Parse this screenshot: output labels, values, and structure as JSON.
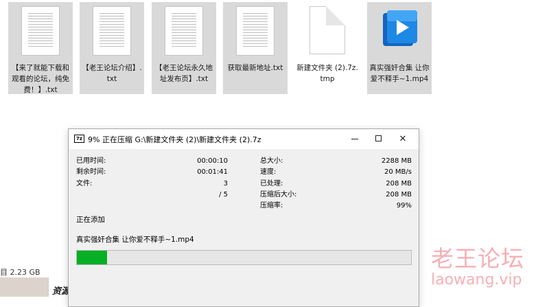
{
  "files": [
    {
      "name": "【来了就能下载和观看的论坛，纯免费！】.txt",
      "kind": "text-document"
    },
    {
      "name": "【老王论坛介绍】.txt",
      "kind": "text-document"
    },
    {
      "name": "【老王论坛永久地址发布页】.txt",
      "kind": "text-document"
    },
    {
      "name": "获取最新地址.txt",
      "kind": "text-document"
    },
    {
      "name": "新建文件夹 (2).7z.tmp",
      "kind": "blank-file"
    },
    {
      "name": "真实强奸合集 让你爱不释手~1.mp4",
      "kind": "video-file"
    }
  ],
  "dialog": {
    "app_icon": "7z",
    "title": "9% 正在压缩 G:\\新建文件夹 (2)\\新建文件夹 (2).7z",
    "window_controls": {
      "close": "✕"
    },
    "stats_left": [
      {
        "label": "已用时间:",
        "value": "00:00:10"
      },
      {
        "label": "剩余时间:",
        "value": "00:01:41"
      },
      {
        "label": "文件:",
        "value": "3"
      },
      {
        "label": "",
        "value": "/ 5"
      }
    ],
    "stats_right": [
      {
        "label": "总大小:",
        "value": "2288 MB"
      },
      {
        "label": "速度:",
        "value": "20 MB/s"
      },
      {
        "label": "已处理:",
        "value": "208 MB"
      },
      {
        "label": "压缩后大小:",
        "value": "208 MB"
      },
      {
        "label": "压缩率:",
        "value": "99%"
      }
    ],
    "status": "正在添加",
    "current_file": "真实强奸合集 让你爱不释手~1.mp4",
    "progress_percent": 9,
    "progress_color": "#06b025"
  },
  "background": {
    "left_status": "目 2.23 GB",
    "resource_text": "资源"
  },
  "watermark": {
    "cn": "老王论坛",
    "en": "laowang.vip",
    "color": "#ef6e79"
  }
}
